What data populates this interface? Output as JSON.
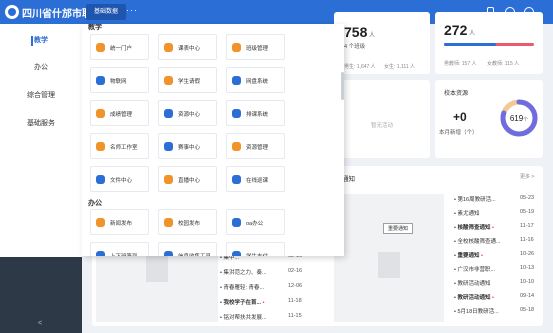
{
  "header": {
    "school": "四川省什邡市职...",
    "tab": "基础数据",
    "more": "···",
    "colors": {
      "bar": "#2b6fd6",
      "active_tab": "#1f56ad"
    }
  },
  "sidebar": {
    "items": [
      {
        "label": "教学",
        "active": true
      },
      {
        "label": "办公",
        "active": false
      },
      {
        "label": "综合管理",
        "active": false
      },
      {
        "label": "基础服务",
        "active": false
      }
    ],
    "collapse": "<"
  },
  "menu": {
    "section1": "教学",
    "teaching": [
      {
        "label": "统一门户",
        "icon": "portal-icon",
        "color": "#f0932b"
      },
      {
        "label": "课表中心",
        "icon": "timetable-icon",
        "color": "#f0932b"
      },
      {
        "label": "班级管理",
        "icon": "class-icon",
        "color": "#f0932b"
      },
      {
        "label": "物联网",
        "icon": "iot-icon",
        "color": "#2b6fd6"
      },
      {
        "label": "学生请假",
        "icon": "leave-icon",
        "color": "#f0932b"
      },
      {
        "label": "网盘系统",
        "icon": "cloud-disk-icon",
        "color": "#2b6fd6"
      },
      {
        "label": "成绩管理",
        "icon": "grade-icon",
        "color": "#f0932b"
      },
      {
        "label": "资源中心",
        "icon": "resource-icon",
        "color": "#2b6fd6"
      },
      {
        "label": "排课系统",
        "icon": "schedule-icon",
        "color": "#2b6fd6"
      },
      {
        "label": "名师工作室",
        "icon": "teacher-icon",
        "color": "#f0932b"
      },
      {
        "label": "赛事中心",
        "icon": "contest-icon",
        "color": "#2b6fd6"
      },
      {
        "label": "资源管理",
        "icon": "resource-manage-icon",
        "color": "#f0932b"
      },
      {
        "label": "文件中心",
        "icon": "file-icon",
        "color": "#2b6fd6"
      },
      {
        "label": "直播中心",
        "icon": "live-icon",
        "color": "#f0932b"
      },
      {
        "label": "在线巡课",
        "icon": "patrol-icon",
        "color": "#2b6fd6"
      }
    ],
    "section2": "办公",
    "office": [
      {
        "label": "新闻发布",
        "icon": "news-icon",
        "color": "#f0932b"
      },
      {
        "label": "校园发布",
        "icon": "campus-icon",
        "color": "#f0932b"
      },
      {
        "label": "oa办公",
        "icon": "oa-icon",
        "color": "#2b6fd6"
      },
      {
        "label": "上下班签到",
        "icon": "checkin-icon",
        "color": "#2b6fd6"
      },
      {
        "label": "信息收集工具",
        "icon": "collect-icon",
        "color": "#2b6fd6"
      },
      {
        "label": "学生支付",
        "icon": "pay-icon",
        "color": "#2b6fd6"
      }
    ]
  },
  "stats": {
    "students": "758",
    "unit": "人",
    "classes": "4 个班级",
    "male_label": "男生:",
    "male": "1,647 人",
    "female_label": "女生:",
    "female": "1,111 人",
    "teachers": "272",
    "unit2": "人",
    "male_t_label": "男教师:",
    "male_t": "157 人",
    "female_t_label": "女教师:",
    "female_t": "115 人",
    "gender_ratio": 0.58,
    "no_activity": "暂无活动",
    "source_title": "校本资源",
    "new_value": "+0",
    "new_label": "本月新增（个）",
    "total": "619",
    "total_unit": "个",
    "ring_fraction": 0.8
  },
  "notice": {
    "title": "通知",
    "more": "更多 >",
    "important_badge": "重要通知",
    "left": [
      {
        "text": "集中...",
        "date": "02-16"
      },
      {
        "text": "集洪范之力、奏...",
        "date": "02-16"
      },
      {
        "text": "青春雁轻: 青春...",
        "date": "12-06"
      },
      {
        "text": "我校学子在首...",
        "date": "11-18",
        "bold": true,
        "dot": true
      },
      {
        "text": "铭对帮扶共发展...",
        "date": "11-15"
      }
    ],
    "right": [
      {
        "text": "第16周教研活...",
        "date": "05-23"
      },
      {
        "text": "素尤通知",
        "date": "05-19"
      },
      {
        "text": "核酸筛查通知",
        "date": "11-17",
        "bold": true,
        "dot": true
      },
      {
        "text": "全校核酸筛查通...",
        "date": "11-16"
      },
      {
        "text": "重要通知",
        "date": "10-26",
        "bold": true,
        "dot": true
      },
      {
        "text": "广汉市非营职...",
        "date": "10-13"
      },
      {
        "text": "教研活动通知",
        "date": "10-10"
      },
      {
        "text": "教研活动通知",
        "date": "09-14",
        "bold": true,
        "dot": true
      },
      {
        "text": "5月18日教研活...",
        "date": "05-18"
      }
    ]
  }
}
